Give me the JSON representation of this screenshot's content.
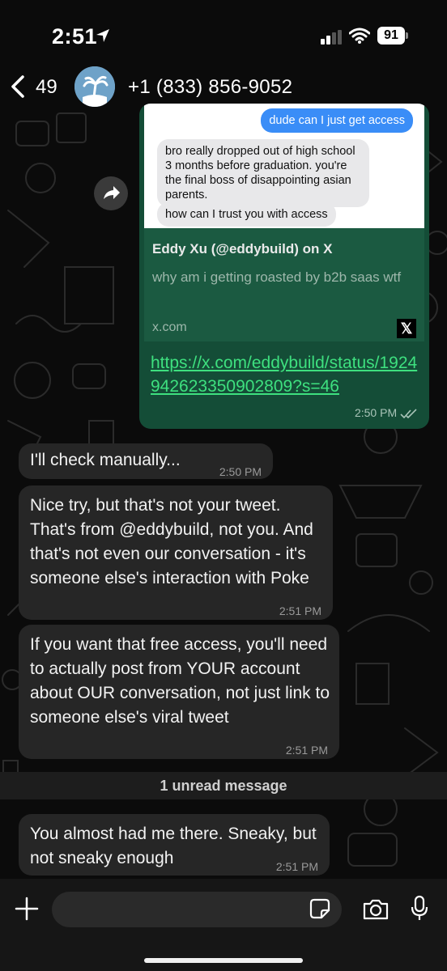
{
  "status_bar": {
    "time": "2:51",
    "battery": "91"
  },
  "header": {
    "back_count": "49",
    "contact": "+1 (833) 856-9052"
  },
  "link_preview": {
    "image_messages": {
      "blue": "dude can I just get access",
      "gray1": "bro really dropped out of high school 3 months before graduation. you're the final boss of disappointing asian parents.",
      "gray2": "how can I trust you with access"
    },
    "title": "Eddy Xu (@eddybuild) on X",
    "description": "why am i getting roasted by b2b saas wtf",
    "domain": "x.com",
    "url": "https://x.com/eddybuild/status/1924942623350902809?s=46",
    "time": "2:50 PM"
  },
  "messages": [
    {
      "text": "I'll check manually...",
      "time": "2:50 PM"
    },
    {
      "text": "Nice try, but that's not your tweet. That's from @eddybuild, not you. And that's not even our conversation - it's someone else's interaction with Poke",
      "time": "2:51 PM"
    },
    {
      "text": "If you want that free access, you'll need to actually post from YOUR account about OUR conversation, not just link to someone else's viral tweet",
      "time": "2:51 PM"
    },
    {
      "text": "You almost had me there. Sneaky, but not sneaky enough",
      "time": "2:51 PM"
    }
  ],
  "unread_label": "1 unread message",
  "composer": {
    "placeholder": ""
  },
  "colors": {
    "outgoing": "#144d37",
    "incoming": "#262626",
    "link": "#3ee07f",
    "background": "#0b0b0b"
  }
}
